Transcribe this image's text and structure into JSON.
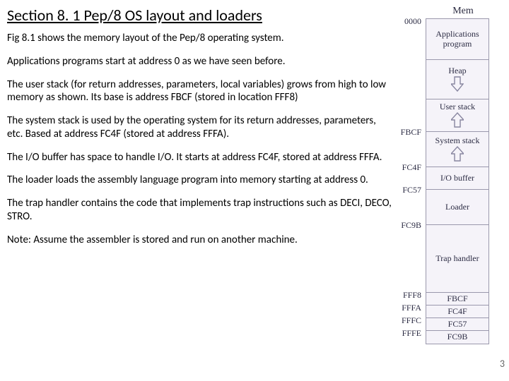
{
  "title": "Section 8. 1  Pep/8 OS layout and loaders",
  "paragraphs": {
    "p1": "Fig 8.1 shows the memory layout of the Pep/8 operating system.",
    "p2": "Applications programs start at address 0 as we have seen before.",
    "p3": "The user stack (for return addresses, parameters, local variables) grows from high to low memory as shown.  Its base is address FBCF (stored in location FFF8)",
    "p4": "The system stack is used by the operating system for its return addresses, parameters, etc.  Based at address FC4F (stored at address FFFA).",
    "p5": "The I/O buffer has space to handle I/O.  It starts at address FC4F, stored at address FFFA.",
    "p6": "The loader loads the assembly language program into memory starting at address 0.",
    "p7": "The trap handler contains the code that implements trap instructions such as DECI, DECO, STRO.",
    "p8": "Note:  Assume the assembler is stored and run on another machine."
  },
  "mem": {
    "label": "Mem",
    "addr": {
      "a0": "0000",
      "a1": "FBCF",
      "a2": "FC4F",
      "a3": "FC57",
      "a4": "FC9B",
      "a5": "FFF8",
      "a6": "FFFA",
      "a7": "FFFC",
      "a8": "FFFE"
    },
    "seg": {
      "s0": "Applications program",
      "s1": "Heap",
      "s2": "User stack",
      "s3": "System stack",
      "s4": "I/O buffer",
      "s5": "Loader",
      "s6": "Trap handler"
    },
    "val": {
      "v0": "FBCF",
      "v1": "FC4F",
      "v2": "FC57",
      "v3": "FC9B"
    }
  },
  "pagenum": "3"
}
